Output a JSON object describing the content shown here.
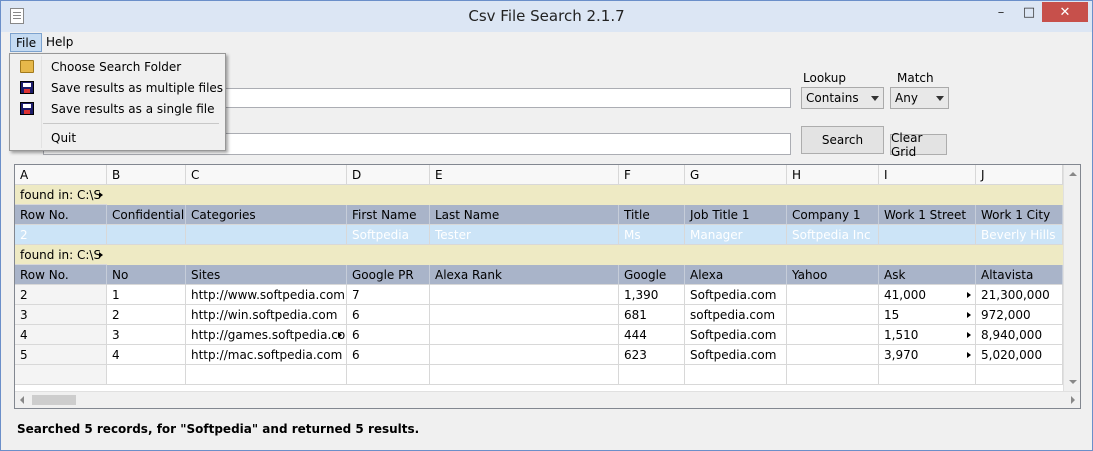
{
  "window": {
    "title": "Csv File Search 2.1.7"
  },
  "menubar": {
    "file": "File",
    "help": "Help"
  },
  "file_menu": {
    "items": [
      {
        "label": "Choose Search Folder",
        "icon": "folder-open-icon"
      },
      {
        "label": "Save results as multiple files",
        "icon": "floppy-disk-icon"
      },
      {
        "label": "Save results as a single file",
        "icon": "floppy-disk-icon"
      },
      {
        "label": "Quit"
      }
    ]
  },
  "controls": {
    "lookup_label": "Lookup",
    "lookup_value": "Contains",
    "match_label": "Match",
    "match_value": "Any",
    "search_button": "Search",
    "clear_button": "Clear Grid"
  },
  "grid": {
    "column_letters": [
      "A",
      "B",
      "C",
      "D",
      "E",
      "F",
      "G",
      "H",
      "I",
      "J"
    ],
    "found1": "found in: C:\\S",
    "header1": [
      "Row No.",
      "Confidential",
      "Categories",
      "First Name",
      "Last Name",
      "Title",
      "Job Title 1",
      "Company 1",
      "Work 1 Street",
      "Work 1 City"
    ],
    "row1": [
      "2",
      "",
      "",
      "Softpedia",
      "Tester",
      "Ms",
      "Manager",
      "Softpedia Inc",
      "",
      "Beverly Hills"
    ],
    "found2": "found in: C:\\S",
    "header2": [
      "Row No.",
      "No",
      "Sites",
      "Google PR",
      "Alexa Rank",
      "Google",
      "Alexa",
      "Yahoo",
      "Ask",
      "Altavista"
    ],
    "rows": [
      [
        "2",
        "1",
        "http://www.softpedia.com",
        "7",
        "",
        "1,390",
        "Softpedia.com",
        "",
        "41,000",
        "21,300,000"
      ],
      [
        "3",
        "2",
        "http://win.softpedia.com",
        "6",
        "",
        "681",
        "softpedia.com",
        "",
        "15",
        "972,000"
      ],
      [
        "4",
        "3",
        "http://games.softpedia.co",
        "6",
        "",
        "444",
        "Softpedia.com",
        "",
        "1,510",
        "8,940,000"
      ],
      [
        "5",
        "4",
        "http://mac.softpedia.com",
        "6",
        "",
        "623",
        "Softpedia.com",
        "",
        "3,970",
        "5,020,000"
      ]
    ]
  },
  "status": "Searched 5 records, for \"Softpedia\" and returned 5 results."
}
